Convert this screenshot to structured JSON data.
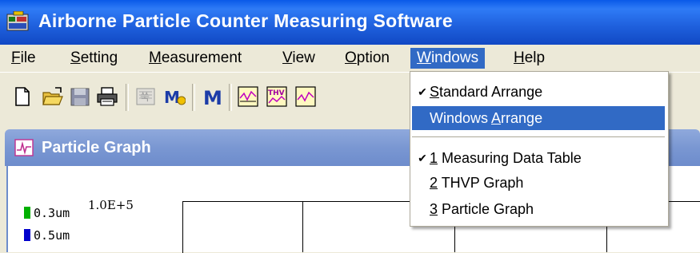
{
  "window": {
    "title": "Airborne Particle Counter Measuring Software"
  },
  "menubar": [
    {
      "pre": "",
      "u": "F",
      "post": "ile"
    },
    {
      "pre": "",
      "u": "S",
      "post": "etting"
    },
    {
      "pre": "",
      "u": "M",
      "post": "easurement"
    },
    {
      "pre": "",
      "u": "V",
      "post": "iew"
    },
    {
      "pre": "",
      "u": "O",
      "post": "ption"
    },
    {
      "pre": "",
      "u": "W",
      "post": "indows"
    },
    {
      "pre": "",
      "u": "H",
      "post": "elp"
    }
  ],
  "windows_menu": [
    {
      "checked": "✔",
      "pre": "",
      "u": "S",
      "post": "tandard Arrange"
    },
    {
      "checked": "",
      "pre": "Windows ",
      "u": "A",
      "post": "rrange"
    },
    {
      "checked": "✔",
      "pre": "",
      "u": "1",
      "post": " Measuring Data Table"
    },
    {
      "checked": "",
      "pre": "",
      "u": "2",
      "post": " THVP Graph"
    },
    {
      "checked": "",
      "pre": "",
      "u": "3",
      "post": " Particle Graph"
    }
  ],
  "child_window": {
    "title": "Particle Graph",
    "legend": [
      {
        "label": "0.3um",
        "color": "#00b000"
      },
      {
        "label": "0.5um",
        "color": "#0000cc"
      }
    ],
    "y_axis_top": "1.0E+5"
  },
  "toolbar": {
    "icons": [
      "new-file-icon",
      "open-folder-icon",
      "save-icon",
      "print-icon",
      "setting-m-icon",
      "measure-m-icon",
      "measurement-m-icon",
      "graph-um-icon",
      "thvp-graph-icon",
      "graph-export-icon"
    ]
  },
  "colors": {
    "titlebar": "#1e5fdc",
    "menu_highlight": "#316ac5",
    "child_titlebar": "#7a97d2"
  }
}
